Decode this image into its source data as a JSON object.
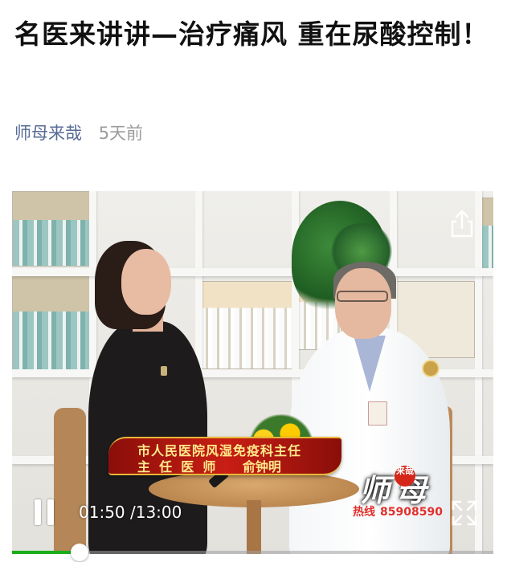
{
  "article": {
    "title": "名医来讲讲—治疗痛风 重在尿酸控制！",
    "author": "师母来哉",
    "time": "5天前"
  },
  "video": {
    "caption_line1": "市人民医院风湿免疫科主任",
    "caption_line2": "主  任  医  师      俞钟明",
    "logo_text": "师母",
    "logo_seal": "来哉",
    "hotline_label": "热线",
    "hotline_number": "85908590",
    "current_time": "01:50",
    "duration": "13:00",
    "time_display": "01:50 /13:00",
    "progress": 0.141
  },
  "icons": {
    "share": "share-icon",
    "pause": "pause-icon",
    "fullscreen": "fullscreen-icon"
  },
  "colors": {
    "author": "#576b95",
    "time": "#9b9b9b",
    "progress": "#1aad19"
  }
}
